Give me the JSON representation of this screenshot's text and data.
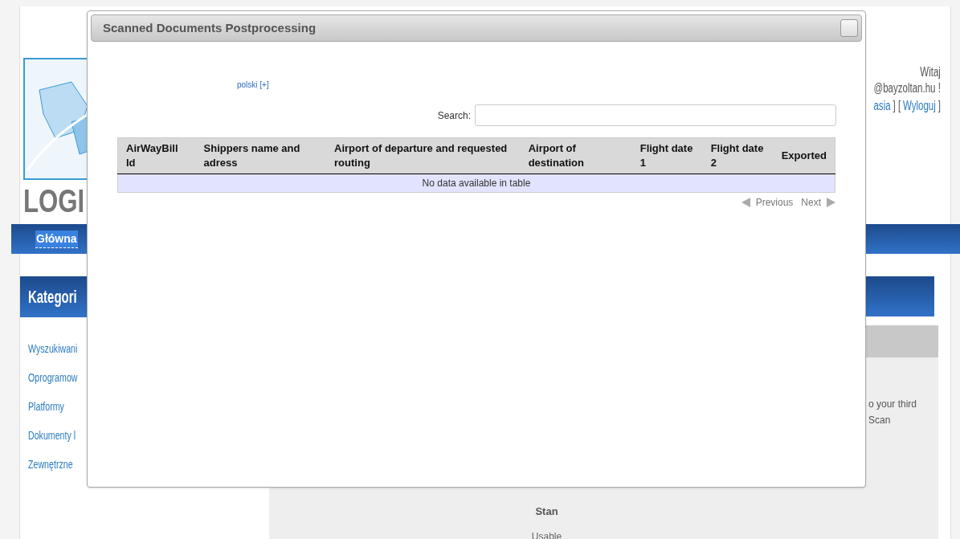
{
  "header": {
    "logo_text": "LOGI",
    "greeting": "Witaj",
    "user": "@bayzoltan.hu !",
    "account_links": [
      {
        "kind": "link",
        "text": "asia"
      },
      {
        "kind": "text",
        "text": "] ["
      },
      {
        "kind": "link",
        "text": "Wyloguj"
      },
      {
        "kind": "text",
        "text": "]"
      }
    ]
  },
  "nav": [
    {
      "label": "Główna",
      "selected": true
    }
  ],
  "sidebar": {
    "title": "Kategori",
    "items": [
      "Wyszukiwani",
      "Oprogramow",
      "Platformy",
      "Dokumenty l",
      "Zewnętrzne"
    ]
  },
  "content": {
    "text_lines": [
      "o your third",
      "Scan"
    ],
    "fields": [
      {
        "label": "Stan",
        "value": "Usable"
      }
    ]
  },
  "modal": {
    "title": "Scanned Documents Postprocessing",
    "language_link": "polski [+]",
    "search": {
      "label": "Search:"
    },
    "table": {
      "columns": [
        "AirWayBill Id",
        "Shippers name and adress",
        "Airport of departure and requested routing",
        "Airport of destination",
        "Flight date 1",
        "Flight date 2",
        "Exported"
      ],
      "empty_message": "No data available in table"
    },
    "pagination": {
      "previous": "Previous",
      "next": "Next"
    }
  }
}
